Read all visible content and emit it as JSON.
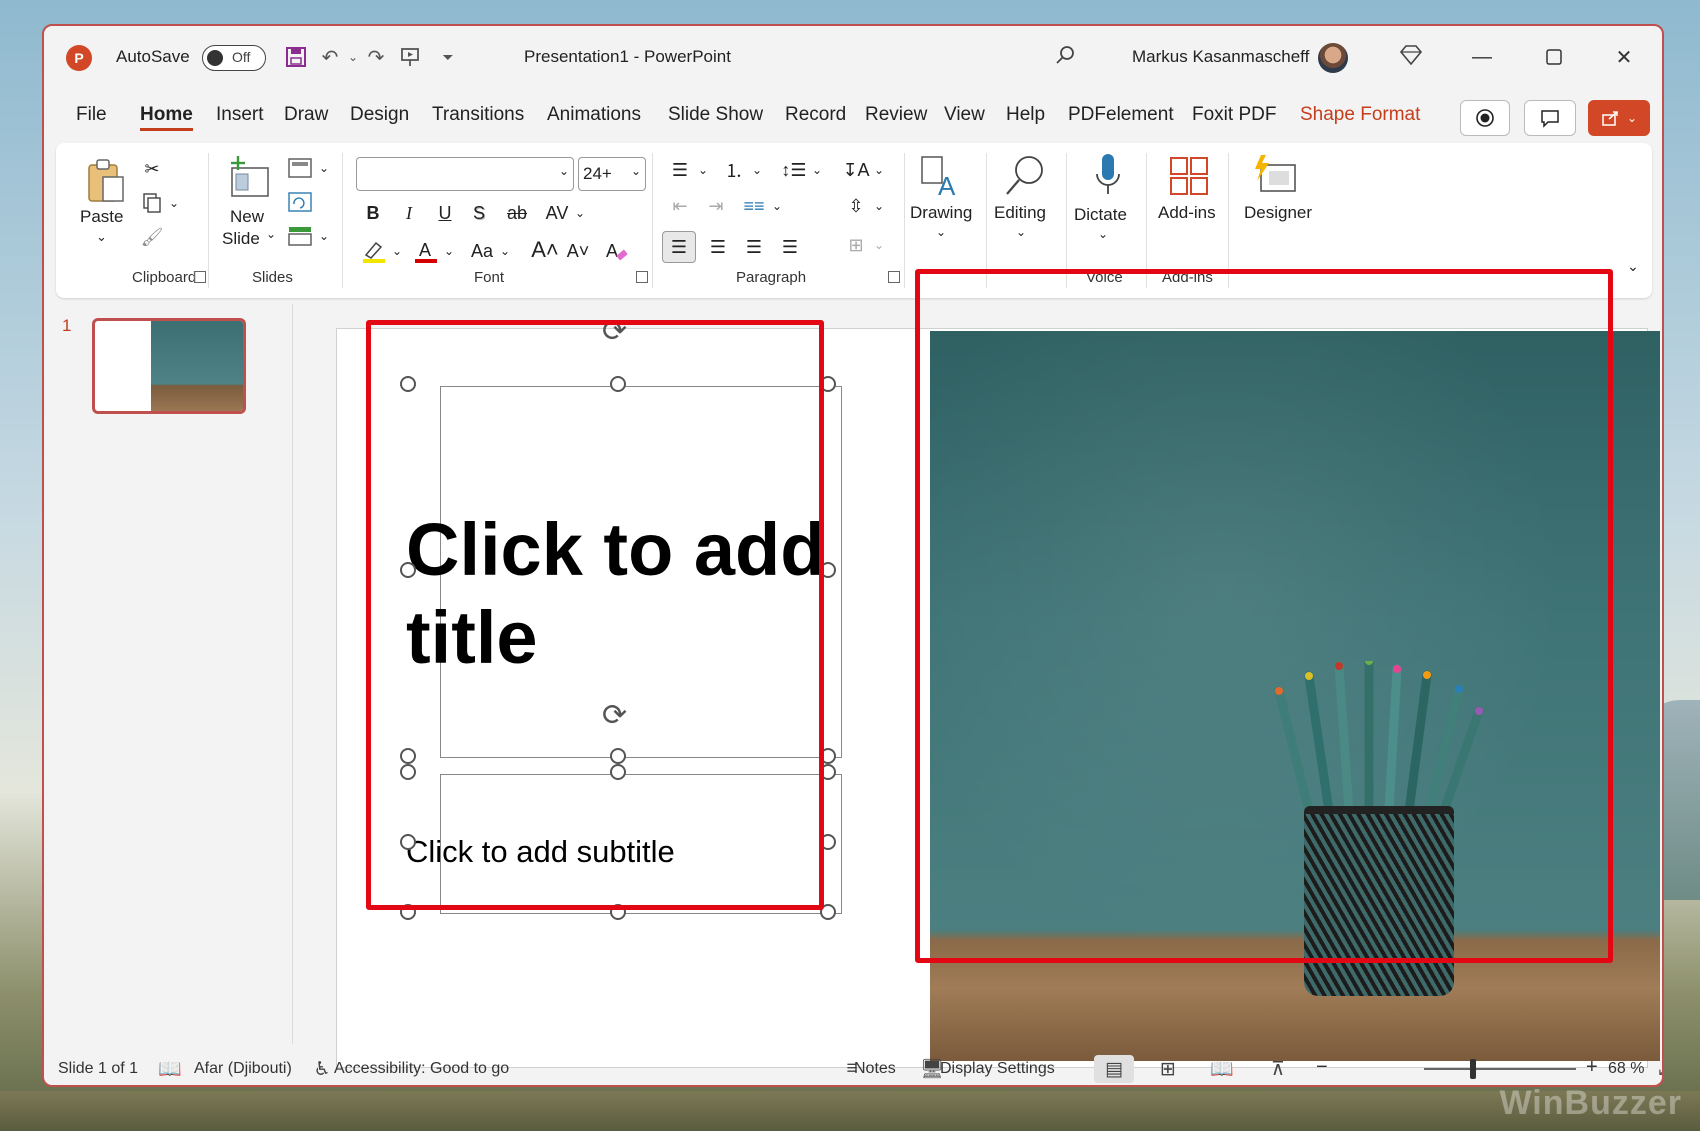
{
  "titlebar": {
    "app_icon": "P",
    "autosave_label": "AutoSave",
    "autosave_state": "Off",
    "doc_title": "Presentation1  -  PowerPoint",
    "user_name": "Markus Kasanmascheff"
  },
  "menu": {
    "items": [
      "File",
      "Home",
      "Insert",
      "Draw",
      "Design",
      "Transitions",
      "Animations",
      "Slide Show",
      "Record",
      "Review",
      "View",
      "Help",
      "PDFelement",
      "Foxit PDF",
      "Shape Format"
    ],
    "active": "Home",
    "accent": "Shape Format"
  },
  "ribbon": {
    "clipboard": {
      "paste": "Paste",
      "label": "Clipboard"
    },
    "slides": {
      "new_slide_line1": "New",
      "new_slide_line2": "Slide",
      "label": "Slides"
    },
    "font": {
      "font_name": "",
      "font_size": "24+",
      "label": "Font",
      "bold": "B",
      "italic": "I",
      "underline": "U",
      "shadow": "S",
      "strike": "ab",
      "spacing": "AV",
      "case": "Aa"
    },
    "paragraph": {
      "label": "Paragraph"
    },
    "drawing": {
      "label": "Drawing"
    },
    "editing": {
      "label": "Editing"
    },
    "voice": {
      "dictate": "Dictate",
      "label": "Voice"
    },
    "addins": {
      "button": "Add-ins",
      "label": "Add-ins"
    },
    "designer": {
      "label": "Designer"
    }
  },
  "thumbs": {
    "slide_number": "1"
  },
  "slide": {
    "title_placeholder": "Click to add title",
    "subtitle_placeholder": "Click to add subtitle"
  },
  "status": {
    "slide_info": "Slide 1 of 1",
    "language": "Afar (Djibouti)",
    "accessibility": "Accessibility: Good to go",
    "notes": "Notes",
    "display_settings": "Display Settings",
    "zoom": "68 %",
    "zoom_minus": "−",
    "zoom_plus": "+"
  },
  "watermark": "WinBuzzer",
  "colors": {
    "accent": "#c43e1c",
    "highlight": "#e30613"
  }
}
